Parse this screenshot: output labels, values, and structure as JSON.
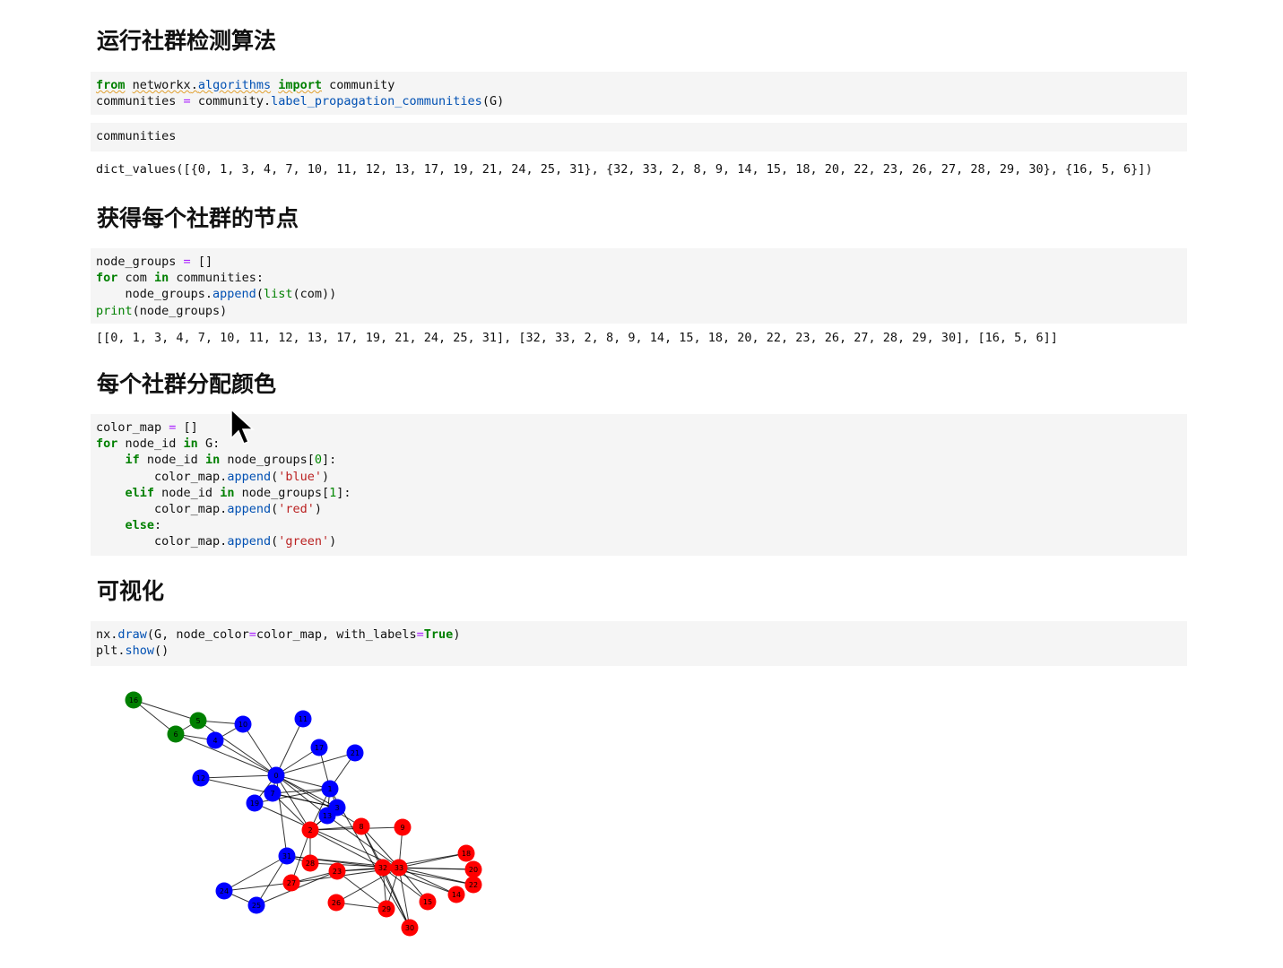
{
  "sections": {
    "s1_title": "运行社群检测算法",
    "s2_title": "获得每个社群的节点",
    "s3_title": "每个社群分配颜色",
    "s4_title": "可视化"
  },
  "cell1": {
    "line1": {
      "kw_from": "from",
      "mod_a": "networkx",
      "dot": ".",
      "mod_b": "algorithms",
      "kw_import": "import",
      "name": "community"
    },
    "line2": {
      "lhs": "communities",
      "op": "=",
      "obj": "community.",
      "fn": "label_propagation_communities",
      "args": "(G)"
    }
  },
  "cell2": {
    "code": "communities"
  },
  "output2": "dict_values([{0, 1, 3, 4, 7, 10, 11, 12, 13, 17, 19, 21, 24, 25, 31}, {32, 33, 2, 8, 9, 14, 15, 18, 20, 22, 23, 26, 27, 28, 29, 30}, {16, 5, 6}])",
  "cell3": {
    "l1_a": "node_groups ",
    "l1_op": "=",
    "l1_b": " []",
    "l2_for": "for",
    "l2_mid": " com ",
    "l2_in": "in",
    "l2_end": " communities:",
    "l3_a": "    node_groups.",
    "l3_fn": "append",
    "l3_p": "(",
    "l3_bi": "list",
    "l3_end": "(com))",
    "l4_bi": "print",
    "l4_end": "(node_groups)"
  },
  "output3": "[[0, 1, 3, 4, 7, 10, 11, 12, 13, 17, 19, 21, 24, 25, 31], [32, 33, 2, 8, 9, 14, 15, 18, 20, 22, 23, 26, 27, 28, 29, 30], [16, 5, 6]]",
  "cell4": {
    "l1_a": "color_map ",
    "l1_op": "=",
    "l1_b": " []",
    "l2_for": "for",
    "l2_mid": " node_id ",
    "l2_in": "in",
    "l2_end": " G:",
    "l3_ind": "    ",
    "l3_if": "if",
    "l3_mid": " node_id ",
    "l3_in": "in",
    "l3_b": " node_groups[",
    "l3_n": "0",
    "l3_end": "]:",
    "l4_a": "        color_map.",
    "l4_fn": "append",
    "l4_p": "(",
    "l4_s": "'blue'",
    "l4_end": ")",
    "l5_ind": "    ",
    "l5_elif": "elif",
    "l5_mid": " node_id ",
    "l5_in": "in",
    "l5_b": " node_groups[",
    "l5_n": "1",
    "l5_end": "]:",
    "l6_a": "        color_map.",
    "l6_fn": "append",
    "l6_p": "(",
    "l6_s": "'red'",
    "l6_end": ")",
    "l7_ind": "    ",
    "l7_else": "else",
    "l7_end": ":",
    "l8_a": "        color_map.",
    "l8_fn": "append",
    "l8_p": "(",
    "l8_s": "'green'",
    "l8_end": ")"
  },
  "cell5": {
    "l1_a": "nx.",
    "l1_fn": "draw",
    "l1_b": "(G, node_color",
    "l1_op": "=",
    "l1_c": "color_map, with_labels",
    "l1_op2": "=",
    "l1_true": "True",
    "l1_end": ")",
    "l2_a": "plt.",
    "l2_fn": "show",
    "l2_end": "()"
  },
  "graph": {
    "colors": {
      "blue": "#0000ff",
      "red": "#ff0000",
      "green": "#008000",
      "edge": "#000000"
    },
    "nodes": [
      {
        "id": "0",
        "c": "blue"
      },
      {
        "id": "1",
        "c": "blue"
      },
      {
        "id": "2",
        "c": "red"
      },
      {
        "id": "3",
        "c": "blue"
      },
      {
        "id": "4",
        "c": "blue"
      },
      {
        "id": "5",
        "c": "green"
      },
      {
        "id": "6",
        "c": "green"
      },
      {
        "id": "7",
        "c": "blue"
      },
      {
        "id": "8",
        "c": "red"
      },
      {
        "id": "9",
        "c": "red"
      },
      {
        "id": "10",
        "c": "blue"
      },
      {
        "id": "11",
        "c": "blue"
      },
      {
        "id": "12",
        "c": "blue"
      },
      {
        "id": "13",
        "c": "blue"
      },
      {
        "id": "14",
        "c": "red"
      },
      {
        "id": "15",
        "c": "red"
      },
      {
        "id": "16",
        "c": "green"
      },
      {
        "id": "17",
        "c": "blue"
      },
      {
        "id": "18",
        "c": "red"
      },
      {
        "id": "19",
        "c": "blue"
      },
      {
        "id": "20",
        "c": "red"
      },
      {
        "id": "21",
        "c": "blue"
      },
      {
        "id": "22",
        "c": "red"
      },
      {
        "id": "23",
        "c": "red"
      },
      {
        "id": "24",
        "c": "blue"
      },
      {
        "id": "25",
        "c": "blue"
      },
      {
        "id": "26",
        "c": "red"
      },
      {
        "id": "27",
        "c": "red"
      },
      {
        "id": "28",
        "c": "red"
      },
      {
        "id": "29",
        "c": "red"
      },
      {
        "id": "30",
        "c": "red"
      },
      {
        "id": "31",
        "c": "blue"
      },
      {
        "id": "32",
        "c": "red"
      },
      {
        "id": "33",
        "c": "red"
      }
    ],
    "edges": [
      [
        "0",
        "1"
      ],
      [
        "0",
        "2"
      ],
      [
        "0",
        "3"
      ],
      [
        "0",
        "4"
      ],
      [
        "0",
        "5"
      ],
      [
        "0",
        "6"
      ],
      [
        "0",
        "7"
      ],
      [
        "0",
        "8"
      ],
      [
        "0",
        "10"
      ],
      [
        "0",
        "11"
      ],
      [
        "0",
        "12"
      ],
      [
        "0",
        "13"
      ],
      [
        "0",
        "17"
      ],
      [
        "0",
        "19"
      ],
      [
        "0",
        "21"
      ],
      [
        "0",
        "31"
      ],
      [
        "1",
        "2"
      ],
      [
        "1",
        "3"
      ],
      [
        "1",
        "7"
      ],
      [
        "1",
        "13"
      ],
      [
        "1",
        "17"
      ],
      [
        "1",
        "19"
      ],
      [
        "1",
        "21"
      ],
      [
        "1",
        "30"
      ],
      [
        "2",
        "3"
      ],
      [
        "2",
        "7"
      ],
      [
        "2",
        "8"
      ],
      [
        "2",
        "9"
      ],
      [
        "2",
        "13"
      ],
      [
        "2",
        "27"
      ],
      [
        "2",
        "28"
      ],
      [
        "2",
        "32"
      ],
      [
        "3",
        "7"
      ],
      [
        "3",
        "12"
      ],
      [
        "3",
        "13"
      ],
      [
        "4",
        "6"
      ],
      [
        "4",
        "10"
      ],
      [
        "5",
        "6"
      ],
      [
        "5",
        "10"
      ],
      [
        "5",
        "16"
      ],
      [
        "6",
        "16"
      ],
      [
        "8",
        "30"
      ],
      [
        "8",
        "32"
      ],
      [
        "8",
        "33"
      ],
      [
        "9",
        "33"
      ],
      [
        "13",
        "33"
      ],
      [
        "14",
        "32"
      ],
      [
        "14",
        "33"
      ],
      [
        "15",
        "32"
      ],
      [
        "15",
        "33"
      ],
      [
        "18",
        "32"
      ],
      [
        "18",
        "33"
      ],
      [
        "19",
        "33"
      ],
      [
        "20",
        "32"
      ],
      [
        "20",
        "33"
      ],
      [
        "22",
        "32"
      ],
      [
        "22",
        "33"
      ],
      [
        "23",
        "25"
      ],
      [
        "23",
        "27"
      ],
      [
        "23",
        "29"
      ],
      [
        "23",
        "32"
      ],
      [
        "23",
        "33"
      ],
      [
        "24",
        "25"
      ],
      [
        "24",
        "27"
      ],
      [
        "24",
        "31"
      ],
      [
        "25",
        "31"
      ],
      [
        "26",
        "29"
      ],
      [
        "26",
        "33"
      ],
      [
        "27",
        "33"
      ],
      [
        "28",
        "31"
      ],
      [
        "28",
        "33"
      ],
      [
        "29",
        "32"
      ],
      [
        "29",
        "33"
      ],
      [
        "30",
        "32"
      ],
      [
        "30",
        "33"
      ],
      [
        "31",
        "32"
      ],
      [
        "31",
        "33"
      ],
      [
        "32",
        "33"
      ]
    ]
  }
}
